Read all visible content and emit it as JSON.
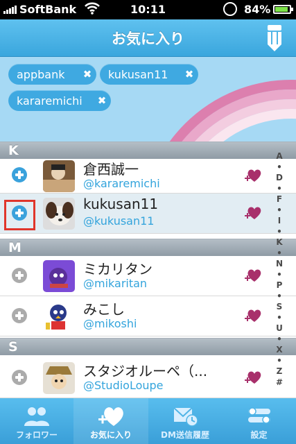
{
  "status_bar": {
    "carrier": "SoftBank",
    "time": "10:11",
    "battery": "84%"
  },
  "nav": {
    "title": "お気に入り"
  },
  "tags": [
    {
      "label": "appbank"
    },
    {
      "label": "kukusan11"
    },
    {
      "label": "kararemichi"
    }
  ],
  "list": {
    "sections": {
      "k": "K",
      "m": "M",
      "s": "S"
    },
    "rows": [
      {
        "name": "倉西誠一",
        "handle": "@kararemichi"
      },
      {
        "name": "kukusan11",
        "handle": "@kukusan11"
      },
      {
        "name": "ミカリタン",
        "handle": "@mikaritan"
      },
      {
        "name": "みこし",
        "handle": "@mikoshi"
      },
      {
        "name": "スタジオルーペ（...",
        "handle": "@StudioLoupe"
      }
    ]
  },
  "index_bar": [
    "A",
    "•",
    "D",
    "•",
    "F",
    "•",
    "I",
    "•",
    "K",
    "•",
    "N",
    "•",
    "P",
    "•",
    "S",
    "•",
    "U",
    "•",
    "X",
    "•",
    "Z",
    "#"
  ],
  "tab_bar": [
    {
      "label": "フォロワー",
      "icon": "followers-icon"
    },
    {
      "label": "お気に入り",
      "icon": "favorite-heart-icon"
    },
    {
      "label": "DM送信履歴",
      "icon": "dm-history-icon"
    },
    {
      "label": "設定",
      "icon": "settings-icon"
    }
  ],
  "colors": {
    "accent": "#3aa6dd",
    "handle": "#33a4dc",
    "heart": "#a8306b",
    "highlight": "#e0352b"
  }
}
